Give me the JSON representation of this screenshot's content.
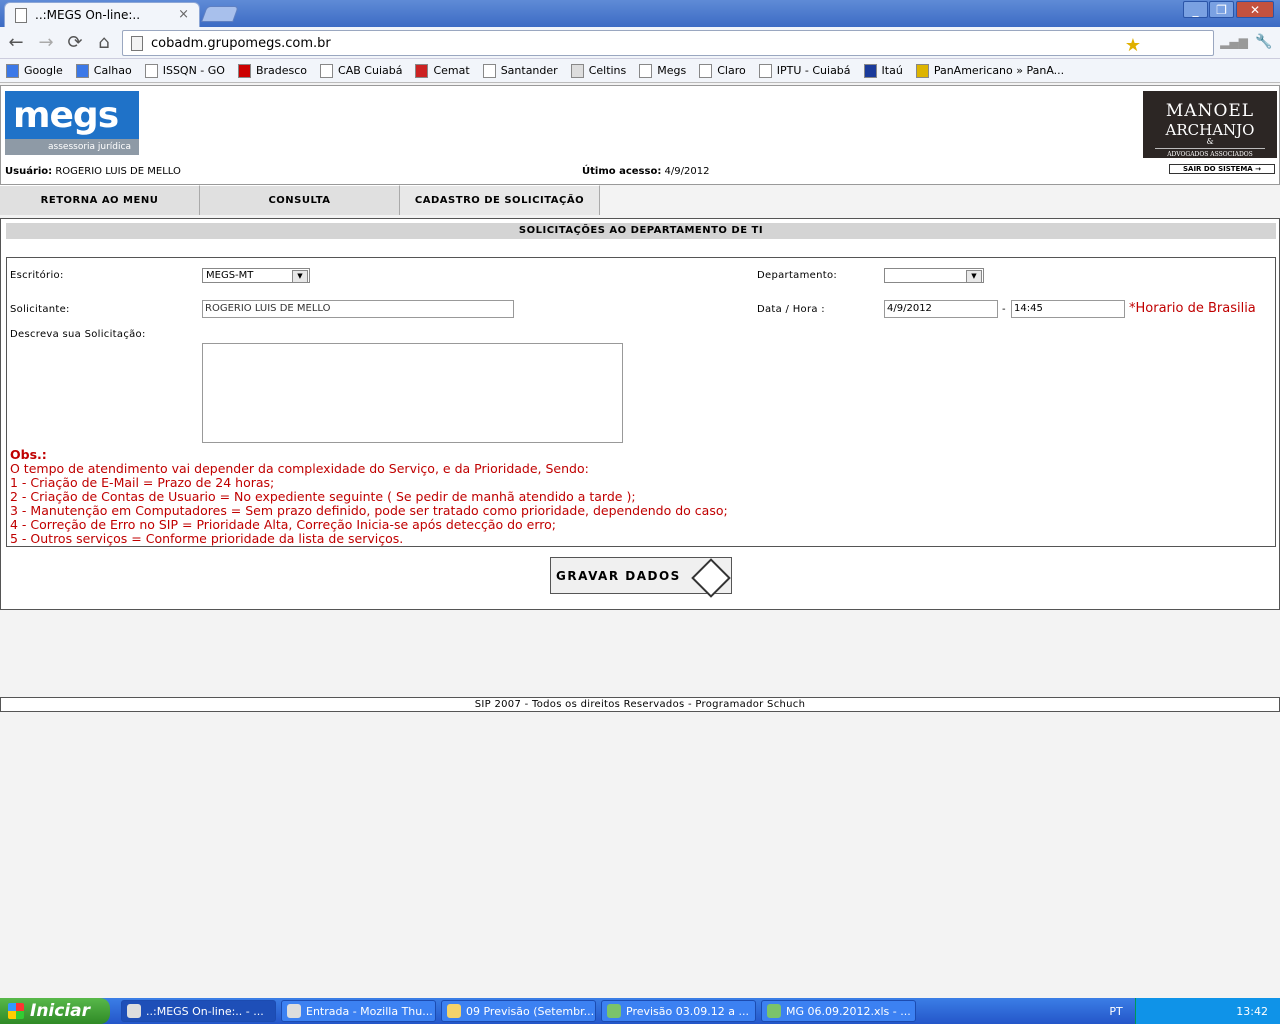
{
  "browser": {
    "tab_title": "..:MEGS On-line:..",
    "tab_close": "×",
    "url": "cobadm.grupomegs.com.br",
    "nav": {
      "back": "←",
      "forward": "→",
      "reload": "⟳",
      "home": "⌂",
      "star": "★",
      "wrench": "🔧"
    },
    "window_controls": {
      "minimize": "_",
      "maximize": "❐",
      "close": "✕"
    },
    "bookmarks": [
      "Google",
      "Calhao",
      "ISSQN - GO",
      "Bradesco",
      "CAB Cuiabá",
      "Cemat",
      "Santander",
      "Celtins",
      "Megs",
      "Claro",
      "IPTU - Cuiabá",
      "Itaú",
      "PanAmericano » PanA..."
    ]
  },
  "header": {
    "logo_word": "megs",
    "logo_sub": "assessoria jurídica",
    "partner_l1": "MANOEL",
    "partner_l2": "ARCHANJO",
    "partner_amp": "&",
    "partner_l3": "ADVOGADOS ASSOCIADOS",
    "user_label": "Usuário:",
    "user_name": "ROGERIO LUIS DE MELLO",
    "access_label": "Útimo acesso:",
    "access_date": "4/9/2012",
    "logout": "SAIR DO SISTEMA →"
  },
  "menu": [
    "RETORNA AO MENU",
    "CONSULTA",
    "CADASTRO DE SOLICITAÇÃO"
  ],
  "form": {
    "title": "SOLICITAÇÕES AO DEPARTAMENTO DE TI",
    "escritorio_label": "Escritório:",
    "escritorio_value": "MEGS-MT",
    "departamento_label": "Departamento:",
    "departamento_value": "",
    "solicitante_label": "Solicitante:",
    "solicitante_value": "ROGERIO LUIS DE MELLO",
    "datahora_label": "Data / Hora :",
    "data_value": "4/9/2012",
    "sep": "-",
    "hora_value": "14:45",
    "hint": "*Horario de Brasilia",
    "descreva_label": "Descreva sua Solicitação:",
    "obs_title": "Obs.:",
    "obs_lines": [
      "O tempo de atendimento vai depender da complexidade do Serviço, e da Prioridade, Sendo:",
      "1 - Criação de E-Mail = Prazo de 24 horas;",
      "2 - Criação de Contas de Usuario = No expediente seguinte ( Se pedir de manhã atendido a tarde );",
      "3 - Manutenção em Computadores = Sem prazo definido, pode ser tratado como prioridade, dependendo do caso;",
      "4 - Correção de Erro no SIP = Prioridade Alta, Correção Inicia-se após detecção do erro;",
      "5 - Outros serviços = Conforme prioridade da lista de serviços."
    ],
    "save_label": "GRAVAR DADOS"
  },
  "footer": "SIP 2007 - Todos os direitos Reservados - Programador Schuch",
  "taskbar": {
    "start": "Iniciar",
    "tasks": [
      "..:MEGS On-line:.. - ...",
      "Entrada - Mozilla Thu...",
      "09 Previsão (Setembr...",
      "Previsão 03.09.12 a ...",
      "MG 06.09.2012.xls - ..."
    ],
    "lang": "PT",
    "clock": "13:42"
  }
}
